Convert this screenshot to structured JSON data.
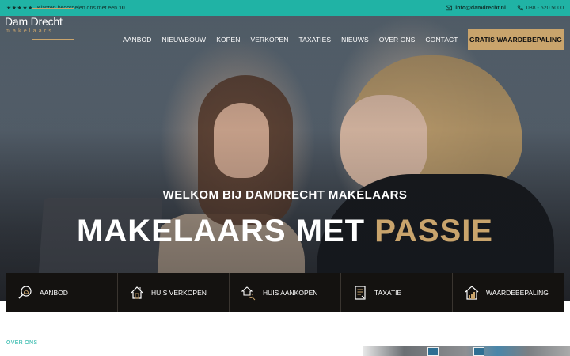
{
  "topbar": {
    "stars": "★★★★★",
    "review_text": "Klanten beoordelen ons met een",
    "review_score": "10",
    "email": "info@damdrecht.nl",
    "phone": "088 - 520 5000"
  },
  "logo": {
    "brand": "Dam Drecht",
    "sub": "makelaars"
  },
  "nav": {
    "items": [
      "AANBOD",
      "NIEUWBOUW",
      "KOPEN",
      "VERKOPEN",
      "TAXATIES",
      "NIEUWS",
      "OVER ONS",
      "CONTACT"
    ],
    "cta": "GRATIS WAARDEBEPALING"
  },
  "hero": {
    "welcome": "WELKOM BIJ DAMDRECHT MAKELAARS",
    "headline_main": "MAKELAARS MET ",
    "headline_accent": "PASSIE"
  },
  "services": [
    {
      "label": "AANBOD",
      "icon": "magnifier-house-icon"
    },
    {
      "label": "HUIS VERKOPEN",
      "icon": "house-sale-icon"
    },
    {
      "label": "HUIS AANKOPEN",
      "icon": "house-key-icon"
    },
    {
      "label": "TAXATIE",
      "icon": "document-icon"
    },
    {
      "label": "WAARDEBEPALING",
      "icon": "house-chart-icon"
    }
  ],
  "section": {
    "label": "OVER ONS"
  },
  "colors": {
    "accent": "#c9a46c",
    "topbar": "#20b3a5",
    "service_bg": "#141210"
  }
}
